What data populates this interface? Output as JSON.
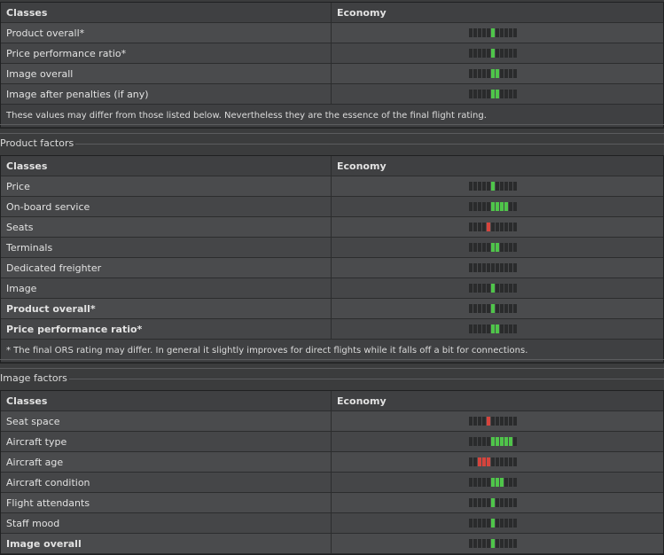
{
  "summary": {
    "header": {
      "label": "Classes",
      "value": "Economy"
    },
    "rows": [
      {
        "label": "Product overall*",
        "rating": {
          "green": [
            6
          ],
          "red": []
        }
      },
      {
        "label": "Price performance ratio*",
        "rating": {
          "green": [
            6
          ],
          "red": []
        }
      },
      {
        "label": "Image overall",
        "rating": {
          "green": [
            6,
            7
          ],
          "red": []
        }
      },
      {
        "label": "Image after penalties (if any)",
        "rating": {
          "green": [
            6,
            7
          ],
          "red": []
        }
      }
    ],
    "note": "These values may differ from those listed below. Nevertheless they are the essence of the final flight rating."
  },
  "product": {
    "title": "Product factors",
    "header": {
      "label": "Classes",
      "value": "Economy"
    },
    "rows": [
      {
        "label": "Price",
        "rating": {
          "green": [
            6
          ],
          "red": []
        }
      },
      {
        "label": "On-board service",
        "rating": {
          "green": [
            6,
            7,
            8,
            9
          ],
          "red": []
        }
      },
      {
        "label": "Seats",
        "rating": {
          "green": [],
          "red": [
            5
          ]
        }
      },
      {
        "label": "Terminals",
        "rating": {
          "green": [
            6,
            7
          ],
          "red": []
        }
      },
      {
        "label": "Dedicated freighter",
        "rating": {
          "green": [],
          "red": []
        }
      },
      {
        "label": "Image",
        "rating": {
          "green": [
            6
          ],
          "red": []
        }
      },
      {
        "label": "Product overall*",
        "rating": {
          "green": [
            6
          ],
          "red": []
        },
        "bold": true
      },
      {
        "label": "Price performance ratio*",
        "rating": {
          "green": [
            6,
            7
          ],
          "red": []
        },
        "bold": true
      }
    ],
    "note": "* The final ORS rating may differ. In general it slightly improves for direct flights while it falls off a bit for connections."
  },
  "image": {
    "title": "Image factors",
    "header": {
      "label": "Classes",
      "value": "Economy"
    },
    "rows": [
      {
        "label": "Seat space",
        "rating": {
          "green": [],
          "red": [
            5
          ]
        }
      },
      {
        "label": "Aircraft type",
        "rating": {
          "green": [
            6,
            7,
            8,
            9,
            10
          ],
          "red": []
        }
      },
      {
        "label": "Aircraft age",
        "rating": {
          "green": [],
          "red": [
            3,
            4,
            5
          ]
        }
      },
      {
        "label": "Aircraft condition",
        "rating": {
          "green": [
            6,
            7,
            8
          ],
          "red": []
        }
      },
      {
        "label": "Flight attendants",
        "rating": {
          "green": [
            6
          ],
          "red": []
        }
      },
      {
        "label": "Staff mood",
        "rating": {
          "green": [
            6
          ],
          "red": []
        }
      },
      {
        "label": "Image overall",
        "rating": {
          "green": [
            6
          ],
          "red": []
        },
        "bold": true
      }
    ]
  },
  "colors": {
    "green": "#4fc54a",
    "red": "#d6443d",
    "empty": "#2a2b2c"
  }
}
